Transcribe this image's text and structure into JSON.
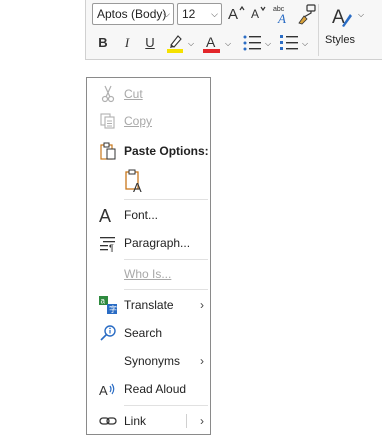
{
  "toolbar": {
    "font_name": "Aptos (Body)",
    "font_size": "12",
    "bold": "B",
    "italic": "I",
    "underline": "U",
    "styles_label": "Styles",
    "highlight_color": "#f5e100",
    "font_color": "#e3262a"
  },
  "menu": {
    "cut": "Cut",
    "copy": "Copy",
    "paste_options": "Paste Options:",
    "font": "Font...",
    "paragraph": "Paragraph...",
    "who_is": "Who Is...",
    "translate": "Translate",
    "search": "Search",
    "synonyms": "Synonyms",
    "read_aloud": "Read Aloud",
    "link": "Link",
    "submenu_arrow": "›"
  }
}
